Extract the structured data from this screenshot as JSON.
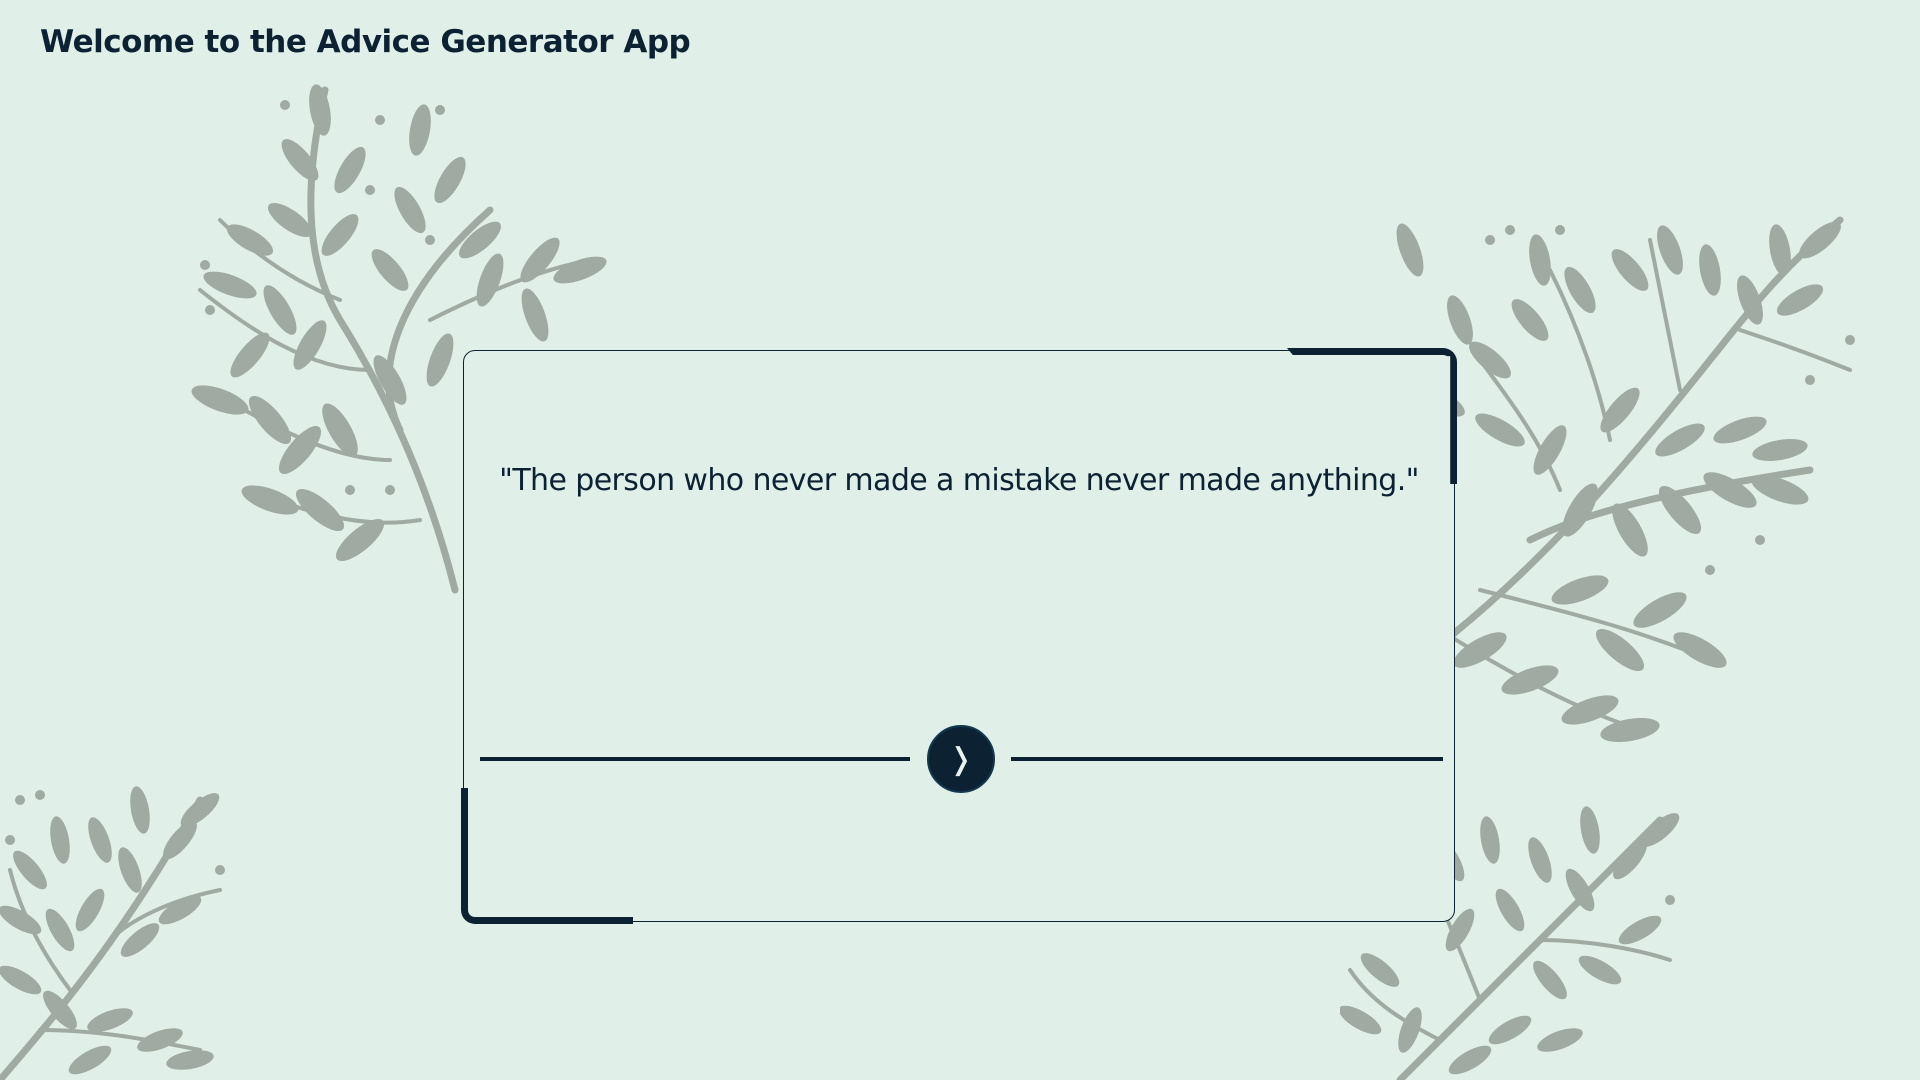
{
  "app": {
    "title": "Welcome to the Advice Generator App"
  },
  "advice": {
    "quote": "\"The person who never made a mistake never made anything.\""
  },
  "next_button": {
    "icon": "chevron-right-icon",
    "glyph": "❭"
  },
  "colors": {
    "background": "#e0efe8",
    "accent": "#0c2233",
    "foliage": "#9eaaa2"
  }
}
